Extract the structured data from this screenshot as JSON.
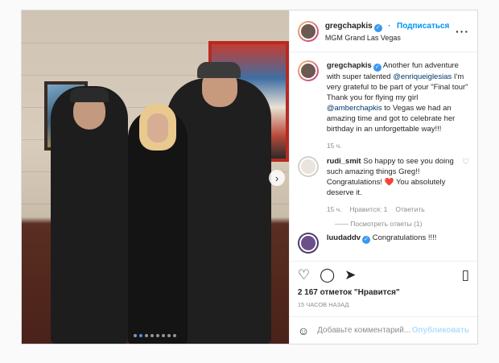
{
  "header": {
    "username": "gregchapkis",
    "follow_label": "Подписаться",
    "location": "MGM Grand Las Vegas",
    "more_icon": "ellipsis-icon"
  },
  "caption": {
    "username": "gregchapkis",
    "text_1": "Another fun adventure with super talented ",
    "mention_1": "@enriqueiglesias",
    "text_2": " I'm very grateful to be part of your \"Final tour\" Thank you for flying my girl ",
    "mention_2": "@amberchapkis",
    "text_3": " to Vegas we had an amazing time and got to celebrate her birthday in an unforgettable way!!!",
    "time": "15 ч."
  },
  "comments": [
    {
      "username": "rudi_smit",
      "text": "So happy to see you doing such amazing things Greg!! Congratulations! ❤️ You absolutely deserve it.",
      "time": "15 ч.",
      "likes": "Нравится: 1",
      "reply_label": "Ответить",
      "view_replies": "Посмотреть ответы (1)"
    },
    {
      "username": "luudaddv",
      "text": "Congratulations !!!!"
    }
  ],
  "actions": {
    "like_icon": "heart-icon",
    "comment_icon": "comment-icon",
    "share_icon": "share-icon",
    "save_icon": "bookmark-icon"
  },
  "likes_text": "2 167 отметок \"Нравится\"",
  "posted_ago": "15 часов назад",
  "add_comment": {
    "placeholder": "Добавьте комментарий...",
    "post_label": "Опубликовать"
  },
  "carousel": {
    "dot_count": 8,
    "active_index": 1
  }
}
